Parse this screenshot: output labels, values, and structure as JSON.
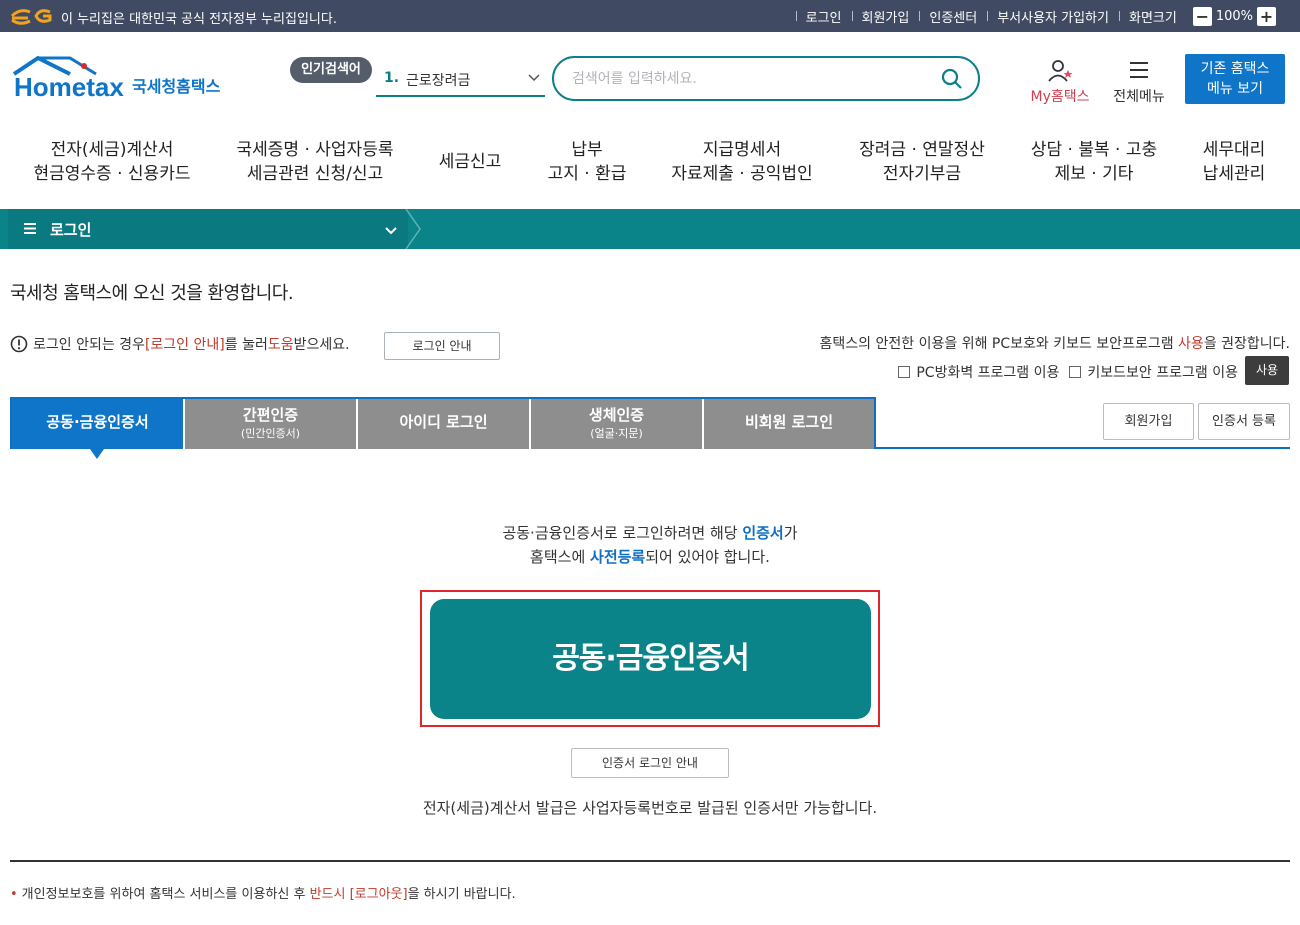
{
  "govbar": {
    "notice": "이 누리집은 대한민국 공식 전자정부 누리집입니다.",
    "links": [
      "로그인",
      "회원가입",
      "인증센터",
      "부서사용자 가입하기",
      "화면크기"
    ],
    "zoom": "100%",
    "zoom_minus": "−",
    "zoom_plus": "+"
  },
  "header": {
    "logo_text": "Hometax",
    "logo_sub": "국세청홈택스",
    "popular_badge": "인기검색어",
    "popular_rank": "1.",
    "popular_term": "근로장려금",
    "search_placeholder": "검색어를 입력하세요.",
    "myhome_prefix": "My",
    "myhome_label": "홈택스",
    "allmenu_label": "전체메뉴",
    "legacy_line1": "기존 홈택스",
    "legacy_line2": "메뉴 보기"
  },
  "gnb": [
    {
      "line1": "전자(세금)계산서",
      "line2": "현금영수증 · 신용카드"
    },
    {
      "line1": "국세증명 · 사업자등록",
      "line2": "세금관련 신청/신고"
    },
    {
      "line1": "세금신고",
      "line2": ""
    },
    {
      "line1": "납부",
      "line2": "고지 · 환급"
    },
    {
      "line1": "지급명세서",
      "line2": "자료제출 · 공익법인"
    },
    {
      "line1": "장려금 · 연말정산",
      "line2": "전자기부금"
    },
    {
      "line1": "상담 · 불복 · 고충",
      "line2": "제보 · 기타"
    },
    {
      "line1": "세무대리",
      "line2": "납세관리"
    }
  ],
  "location": {
    "label": "로그인"
  },
  "content": {
    "welcome": "국세청 홈택스에 오신 것을 환영합니다.",
    "help_pre": "로그인 안되는 경우 ",
    "help_link": "[로그인 안내]",
    "help_mid": "를 눌러 ",
    "help_red": "도움",
    "help_post": "받으세요.",
    "guide_button": "로그인 안내",
    "security_pre": "홈택스의 안전한 이용을 위해 PC보호와 키보드 보안프로그램 ",
    "security_red": "사용",
    "security_post": "을 권장합니다.",
    "opt_pc": "PC방화벽 프로그램 이용",
    "opt_kb": "키보드보안 프로그램 이용",
    "use_button": "사용"
  },
  "tabs": [
    {
      "label": "공동·금융인증서",
      "sub": ""
    },
    {
      "label": "간편인증",
      "sub": "(민간인증서)"
    },
    {
      "label": "아이디 로그인",
      "sub": ""
    },
    {
      "label": "생체인증",
      "sub": "(얼굴·지문)"
    },
    {
      "label": "비회원 로그인",
      "sub": ""
    }
  ],
  "side_buttons": {
    "join": "회원가입",
    "cert_register": "인증서 등록"
  },
  "panel": {
    "msg1_pre": "공동·금융인증서로 로그인하려면 해당 ",
    "msg1_blue": "인증서",
    "msg1_post": "가",
    "msg2_pre": "홈택스에 ",
    "msg2_blue": "사전등록",
    "msg2_post": "되어 있어야 합니다.",
    "cert_button": "공동·금융인증서",
    "cert_guide_button": "인증서 로그인 안내",
    "note": "전자(세금)계산서 발급은 사업자등록번호로 발급된 인증서만 가능합니다."
  },
  "footer": {
    "bullet": "•",
    "note_pre": "개인정보보호를 위하여 홈택스 서비스를 이용하신 후 ",
    "note_red": "반드시 [로그아웃]",
    "note_post": "을 하시기 바랍니다."
  },
  "colors": {
    "teal": "#0a8389",
    "blue": "#0f75c9",
    "govbar": "#404a63",
    "red": "#e0262c"
  }
}
